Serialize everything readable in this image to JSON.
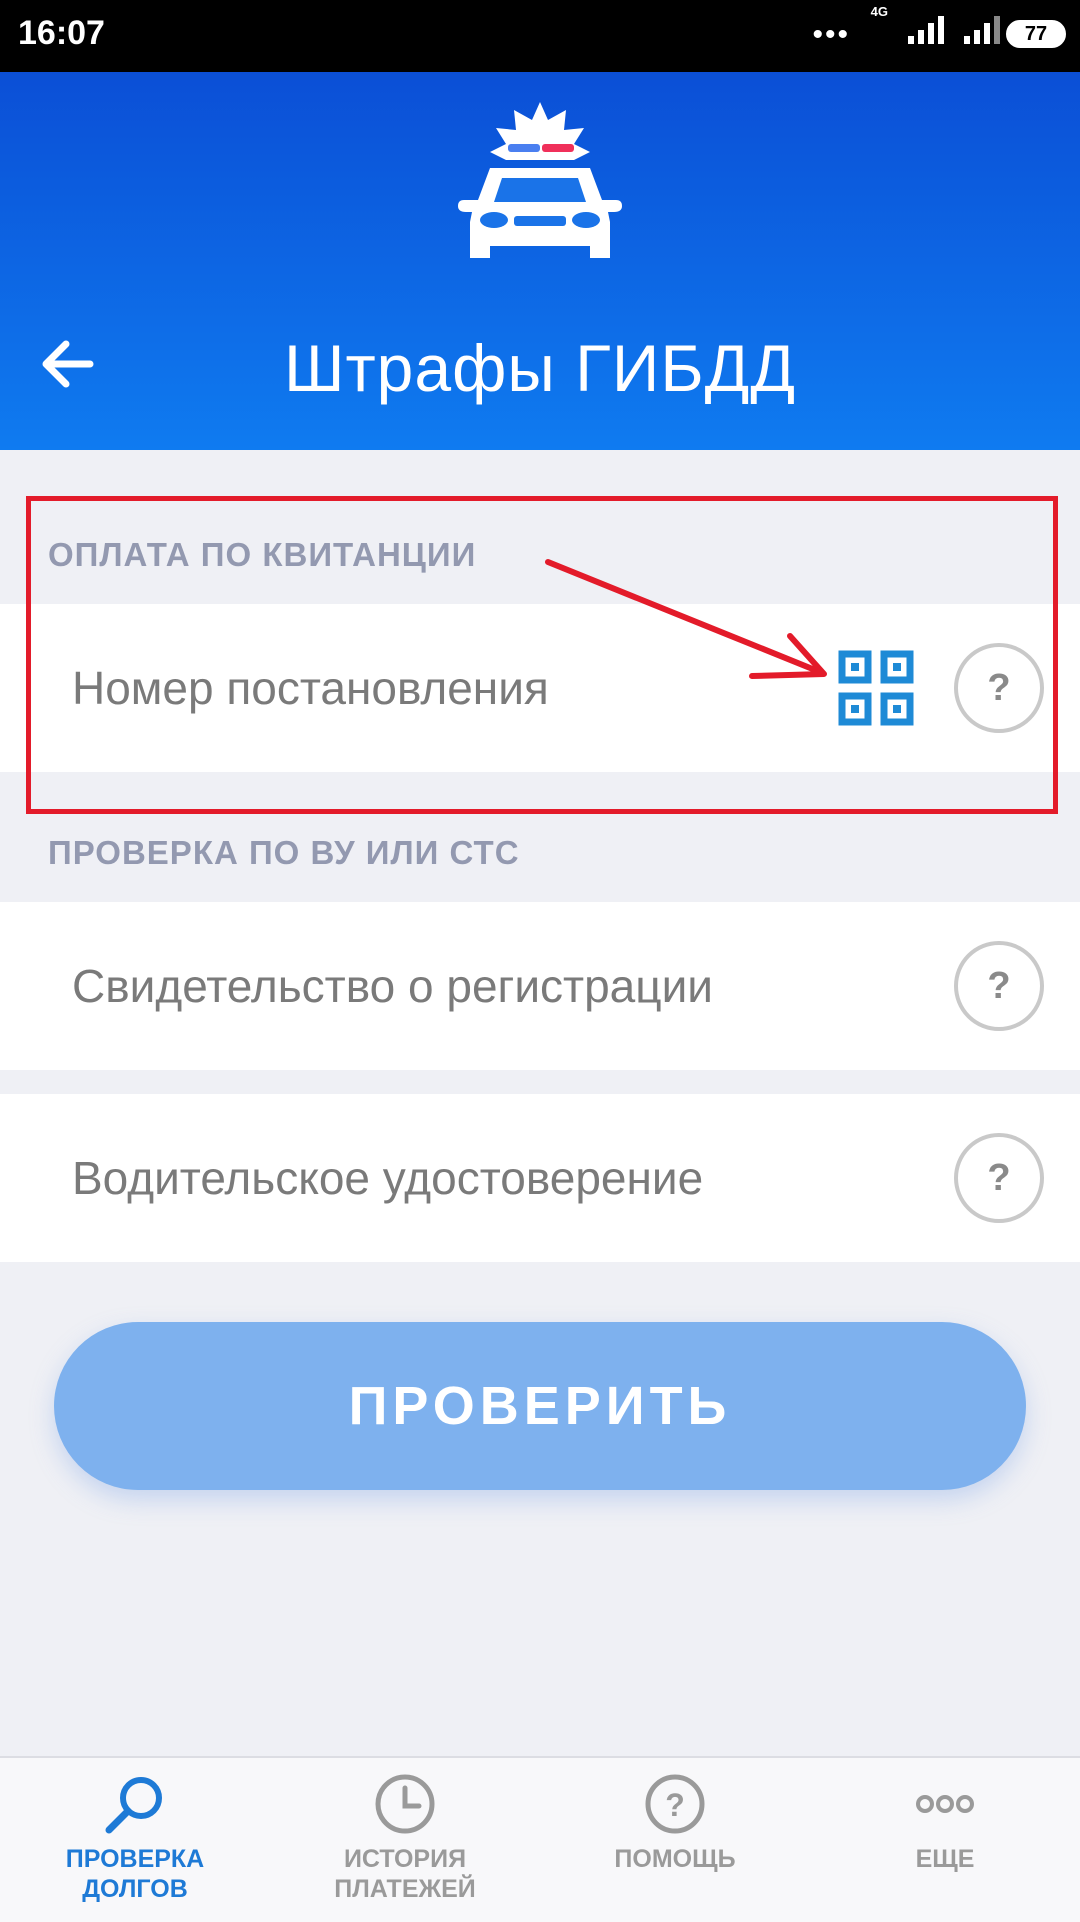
{
  "status_bar": {
    "time": "16:07",
    "network": "4G",
    "battery": "77",
    "dots": "•••"
  },
  "header": {
    "title": "Штрафы ГИБДД",
    "logo_icon": "police-car-icon",
    "back_icon": "arrow-left-icon"
  },
  "sections": {
    "receipt": {
      "label": "ОПЛАТА ПО КВИТАНЦИИ",
      "field_placeholder": "Номер постановления",
      "qr_icon": "qr-code-icon",
      "help_label": "?"
    },
    "documents": {
      "label": "ПРОВЕРКА ПО ВУ ИЛИ СТС",
      "fields": [
        {
          "placeholder": "Свидетельство о регистрации",
          "help_label": "?"
        },
        {
          "placeholder": "Водительское удостоверение",
          "help_label": "?"
        }
      ]
    }
  },
  "check_button": {
    "label": "ПРОВЕРИТЬ"
  },
  "bottom_nav": {
    "items": [
      {
        "line1": "ПРОВЕРКА",
        "line2": "ДОЛГОВ",
        "icon": "search-icon",
        "active": true
      },
      {
        "line1": "ИСТОРИЯ",
        "line2": "ПЛАТЕЖЕЙ",
        "icon": "clock-icon",
        "active": false
      },
      {
        "line1": "ПОМОЩЬ",
        "line2": "",
        "icon": "help-circle-icon",
        "active": false
      },
      {
        "line1": "ЕЩЕ",
        "line2": "",
        "icon": "more-icon",
        "active": false
      }
    ]
  },
  "colors": {
    "header_top": "#0b4fd6",
    "header_bottom": "#0f7bf0",
    "accent": "#1e7ad6",
    "button": "#7eb1ee",
    "annotation": "#e31b2a"
  }
}
